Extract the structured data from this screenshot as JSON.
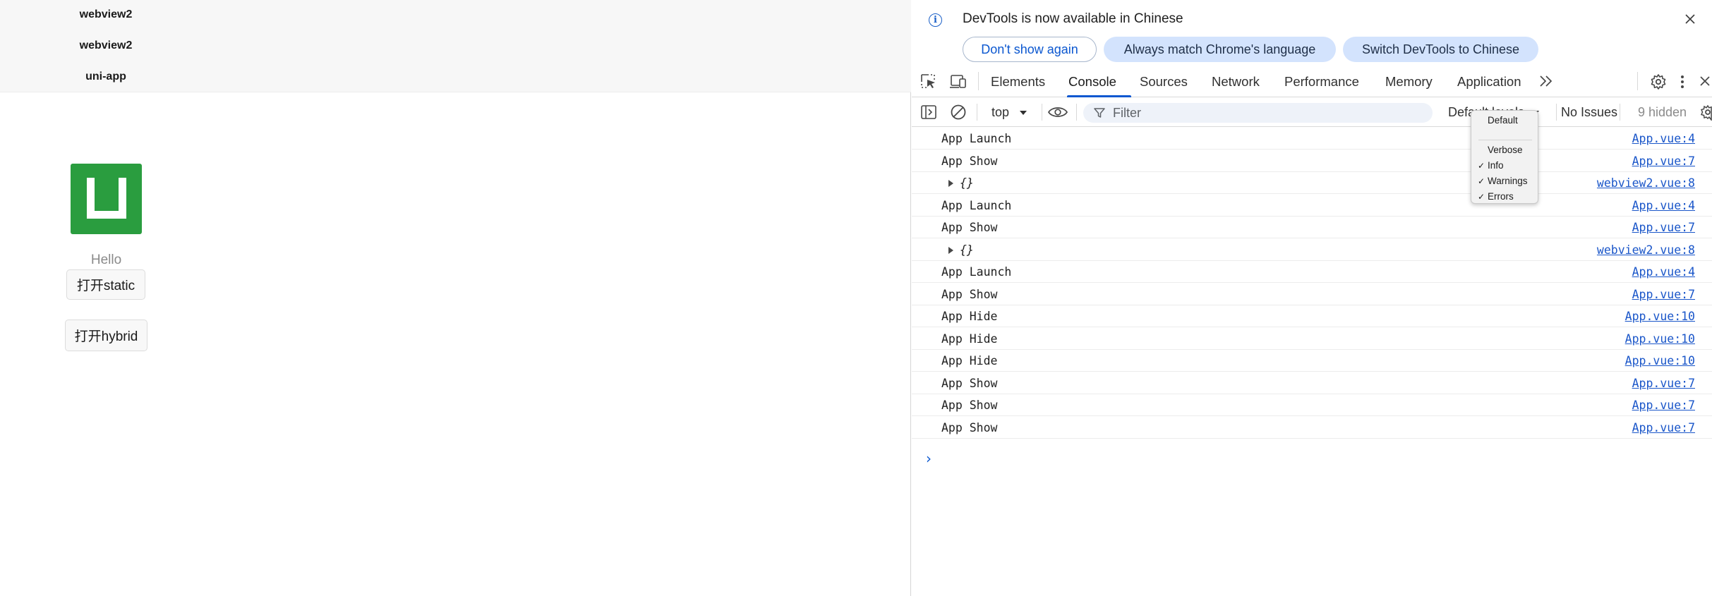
{
  "app": {
    "nav_items": [
      "webview2",
      "webview2",
      "uni-app"
    ],
    "hello": "Hello",
    "buttons": {
      "open_static": "打开static",
      "open_hybrid": "打开hybrid"
    }
  },
  "devtools": {
    "banner": {
      "title": "DevTools is now available in Chinese",
      "dont_show": "Don't show again",
      "always_match": "Always match Chrome's language",
      "switch": "Switch DevTools to Chinese"
    },
    "tabs": [
      "Elements",
      "Console",
      "Sources",
      "Network",
      "Performance",
      "Memory",
      "Application"
    ],
    "active_tab": "Console",
    "toolbar": {
      "context": "top",
      "filter_placeholder": "Filter",
      "levels": "Default levels",
      "issues": "No Issues",
      "hidden": "9 hidden"
    },
    "levels_menu": {
      "items": [
        {
          "label": "Default",
          "checked": false
        },
        {
          "label": "Verbose",
          "checked": false
        },
        {
          "label": "Info",
          "checked": true
        },
        {
          "label": "Warnings",
          "checked": true
        },
        {
          "label": "Errors",
          "checked": true
        }
      ]
    },
    "console": {
      "rows": [
        {
          "text": "App Launch",
          "source": "App.vue:4",
          "kind": "text"
        },
        {
          "text": "App Show",
          "source": "App.vue:7",
          "kind": "text"
        },
        {
          "text": "{}",
          "source": "webview2.vue:8",
          "kind": "object"
        },
        {
          "text": "App Launch",
          "source": "App.vue:4",
          "kind": "text"
        },
        {
          "text": "App Show",
          "source": "App.vue:7",
          "kind": "text"
        },
        {
          "text": "{}",
          "source": "webview2.vue:8",
          "kind": "object"
        },
        {
          "text": "App Launch",
          "source": "App.vue:4",
          "kind": "text"
        },
        {
          "text": "App Show",
          "source": "App.vue:7",
          "kind": "text"
        },
        {
          "text": "App Hide",
          "source": "App.vue:10",
          "kind": "text"
        },
        {
          "text": "App Hide",
          "source": "App.vue:10",
          "kind": "text"
        },
        {
          "text": "App Hide",
          "source": "App.vue:10",
          "kind": "text"
        },
        {
          "text": "App Show",
          "source": "App.vue:7",
          "kind": "text"
        },
        {
          "text": "App Show",
          "source": "App.vue:7",
          "kind": "text"
        },
        {
          "text": "App Show",
          "source": "App.vue:7",
          "kind": "text"
        }
      ],
      "prompt": "›"
    },
    "icons": {
      "info": "info-icon",
      "close": "close-icon",
      "inspect": "inspect-element-icon",
      "device": "device-toolbar-icon",
      "more_tabs": "more-tabs-icon",
      "settings": "gear-icon",
      "kebab": "more-options-icon",
      "sidebar": "sidebar-toggle-icon",
      "clear": "clear-console-icon",
      "eye": "live-expression-icon",
      "filter": "filter-icon"
    },
    "colors": {
      "accent": "#0b57d0",
      "link": "#1a56c9",
      "chip": "#d3e3fd",
      "logo": "#2a9d3f"
    }
  }
}
